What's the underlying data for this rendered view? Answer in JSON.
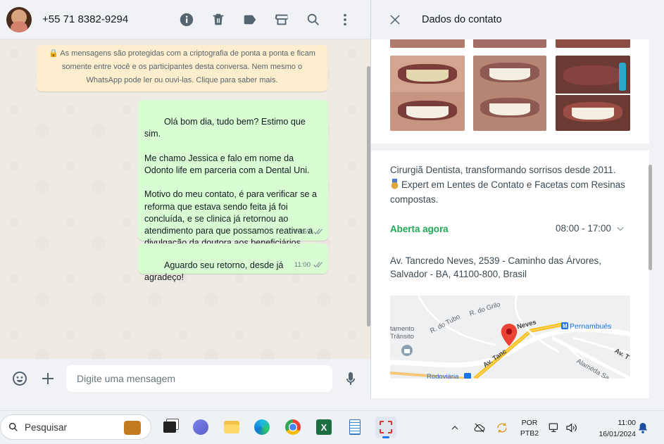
{
  "chat": {
    "contact_phone": "+55 71 8382-9294",
    "encryption_notice": "🔒 As mensagens são protegidas com a criptografia de ponta a ponta e ficam somente entre você e os participantes desta conversa. Nem mesmo o WhatsApp pode ler ou ouvi-las. Clique para saber mais.",
    "messages": [
      {
        "text": "Olá bom dia, tudo bem? Estimo que sim.\n\nMe chamo Jessica e falo em nome da Odonto life em parceria com a Dental Uni.\n\nMotivo do meu contato, é para verificar se a reforma que estava sendo feita já foi concluída, e se clinica já retornou ao atendimento para que possamos reativar a divulgação da doutora aos beneficiários.",
        "time": "10:59"
      },
      {
        "text": "Aguardo seu retorno, desde já agradeço!",
        "time": "11:00"
      }
    ],
    "compose_placeholder": "Digite uma mensagem",
    "header_icons": [
      "info-icon",
      "trash-icon",
      "label-icon",
      "store-icon",
      "search-icon",
      "menu-icon"
    ]
  },
  "contact_panel": {
    "title": "Dados do contato",
    "bio_line1": "Cirurgiã Dentista, transformando sorrisos desde 2011.",
    "bio_line2": "Expert em Lentes de Contato e Facetas com Resinas compostas.",
    "open_status": "Aberta agora",
    "hours": "08:00 - 17:00",
    "address": "Av. Tancredo Neves, 2539 - Caminho das Árvores, Salvador - BA, 41100-800, Brasil",
    "map_labels": {
      "r_do_tubo": "R. do Tubo",
      "r_do_grilo": "R. do Grilo",
      "transito_1": "tamento",
      "transito_2": "Trânsito",
      "neves": "Neves",
      "pernambues": "Pernambués",
      "av_tanc": "Av. Tanc",
      "av_t": "Av. T",
      "alameda": "Alameda Sa",
      "rodoviaria": "Rodoviária"
    },
    "status_color": "#1fa855"
  },
  "taskbar": {
    "search_placeholder": "Pesquisar",
    "lang_line1": "POR",
    "lang_line2": "PTB2",
    "time": "11:00",
    "date": "16/01/2024"
  }
}
